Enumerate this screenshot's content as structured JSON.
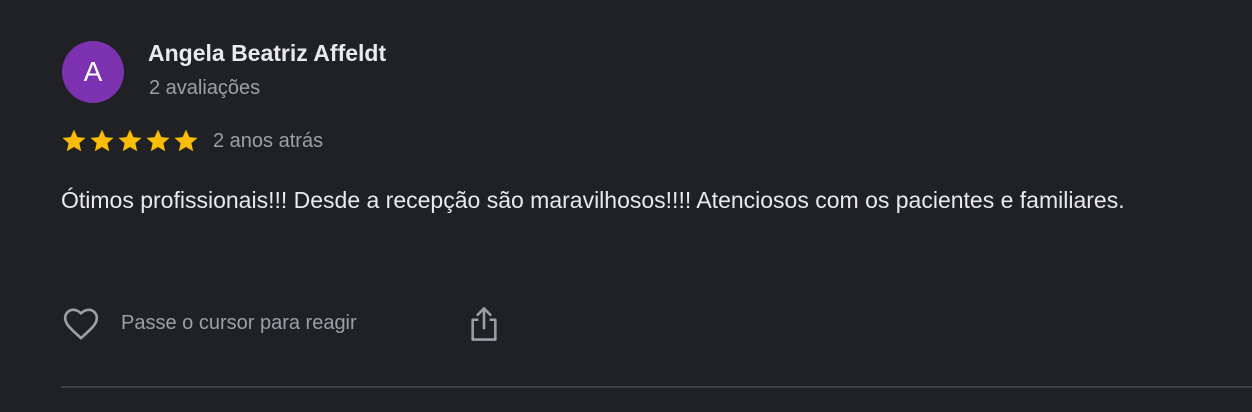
{
  "review": {
    "avatar_letter": "A",
    "avatar_color": "#7b31b0",
    "reviewer_name": "Angela Beatriz Affeldt",
    "reviewer_reviews": "2 avaliações",
    "rating": 5,
    "rating_max": 5,
    "star_color": "#fbbc04",
    "date": "2 anos atrás",
    "text": "Ótimos profissionais!!! Desde a recepção são maravilhosos!!!! Atenciosos com os pacientes e familiares."
  },
  "actions": {
    "react_icon": "heart-outline-icon",
    "react_label": "Passe o cursor para reagir",
    "share_icon": "share-icon"
  }
}
